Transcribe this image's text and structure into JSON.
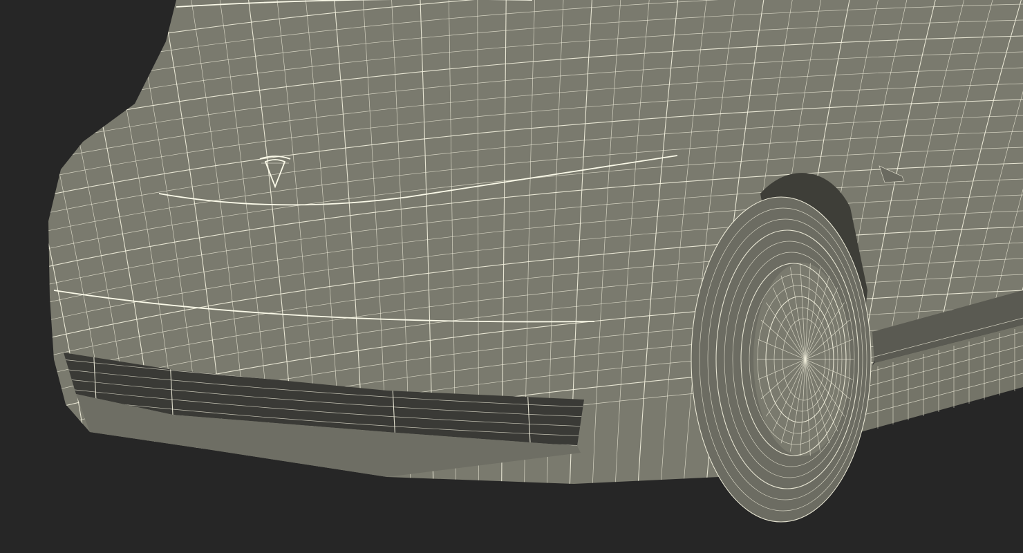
{
  "scene": {
    "subject": "tesla-semi-wireframe-front",
    "colors": {
      "background": "#262626",
      "body": "#7a7a6e",
      "body_shadow": "#5e5e55",
      "wire": "#f4f2df",
      "grille": "#3a3a36",
      "tire": "#6c6c62"
    }
  }
}
